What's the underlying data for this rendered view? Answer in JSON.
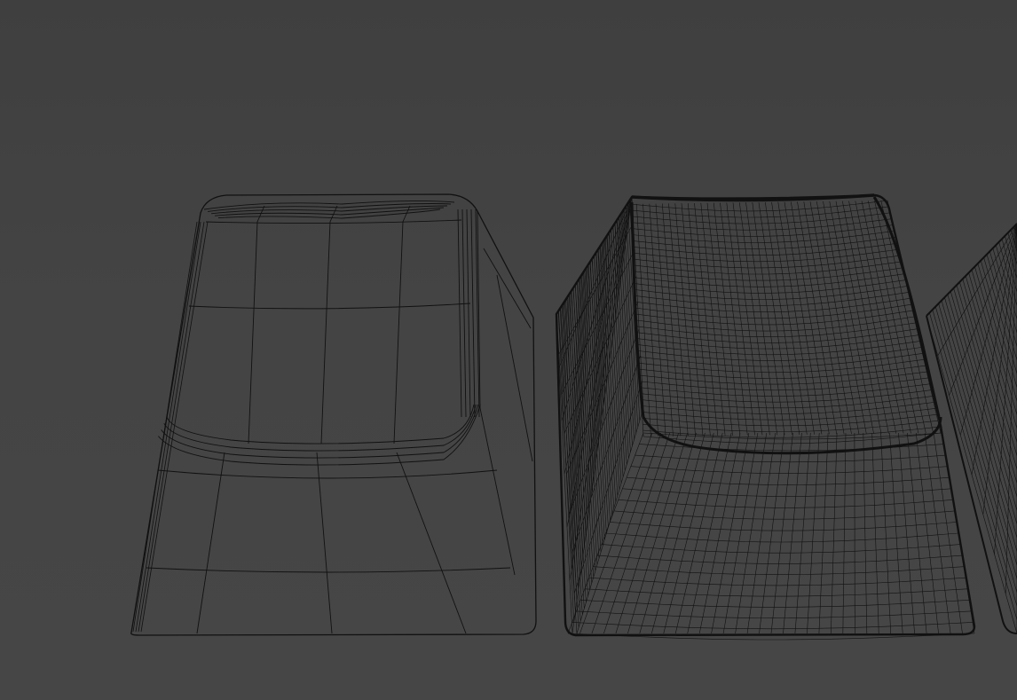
{
  "scene": {
    "background_color": "#414141",
    "wire_color": "#111111",
    "objects": [
      {
        "name": "keycap-low-poly",
        "mesh_density": "low"
      },
      {
        "name": "keycap-subdivided",
        "mesh_density": "high"
      },
      {
        "name": "keycap-partial-right",
        "mesh_density": "high"
      }
    ]
  }
}
